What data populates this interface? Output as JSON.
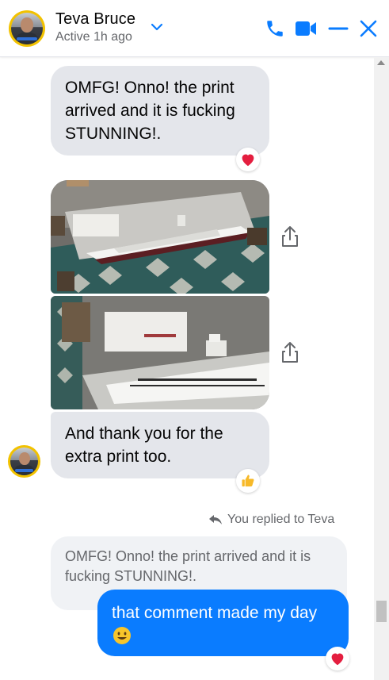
{
  "header": {
    "contact_name": "Teva Bruce",
    "status": "Active 1h ago",
    "icons": [
      "chevron-down-icon",
      "phone-icon",
      "video-icon",
      "minimize-icon",
      "close-icon"
    ],
    "accent_color": "#0a7cff"
  },
  "messages": {
    "m1": {
      "text": "OMFG! Onno! the print arrived and it is fucking STUNNING!.",
      "reaction": "heart"
    },
    "photos": [
      {
        "kind": "photo",
        "subject": "ship-print"
      },
      {
        "kind": "photo",
        "subject": "ship-print"
      }
    ],
    "m2": {
      "text": "And thank you for the extra print too.",
      "reaction": "thumbs-up"
    },
    "reply_indicator": "You replied to Teva",
    "quoted_text": "OMFG! Onno! the print arrived and it is fucking STUNNING!.",
    "m3": {
      "text": "that comment made my day",
      "emoji": "😀",
      "reaction": "heart"
    }
  },
  "colors": {
    "incoming_bubble": "#e4e6eb",
    "outgoing_bubble": "#0a7cff",
    "heart": "#e41e3f",
    "thumbs": "#f7b928"
  }
}
